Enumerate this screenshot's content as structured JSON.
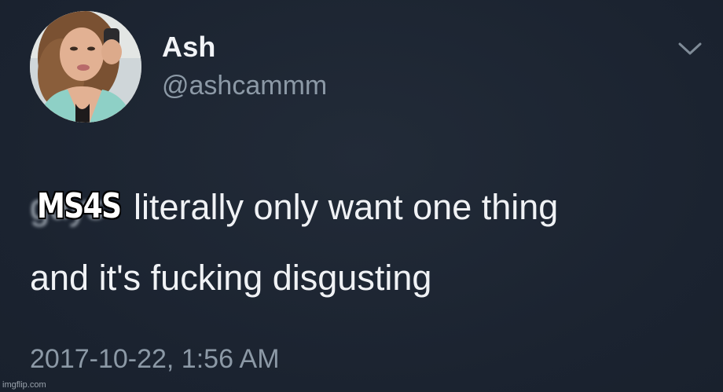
{
  "tweet": {
    "author": {
      "display_name": "Ash",
      "handle": "@ashcammm"
    },
    "text_line_1_rest": "literally only want one thing",
    "text_line_2": "and it's fucking disgusting",
    "obscured_word": "guys",
    "timestamp": "2017-10-22, 1:56 AM"
  },
  "overlay": {
    "caption": "MS4S"
  },
  "watermark": {
    "text": "imgflip.com"
  },
  "icons": {
    "menu": "chevron-down-icon"
  },
  "colors": {
    "background": "#1b2330",
    "primary_text": "#f0f2f5",
    "secondary_text": "#8c99a6"
  }
}
